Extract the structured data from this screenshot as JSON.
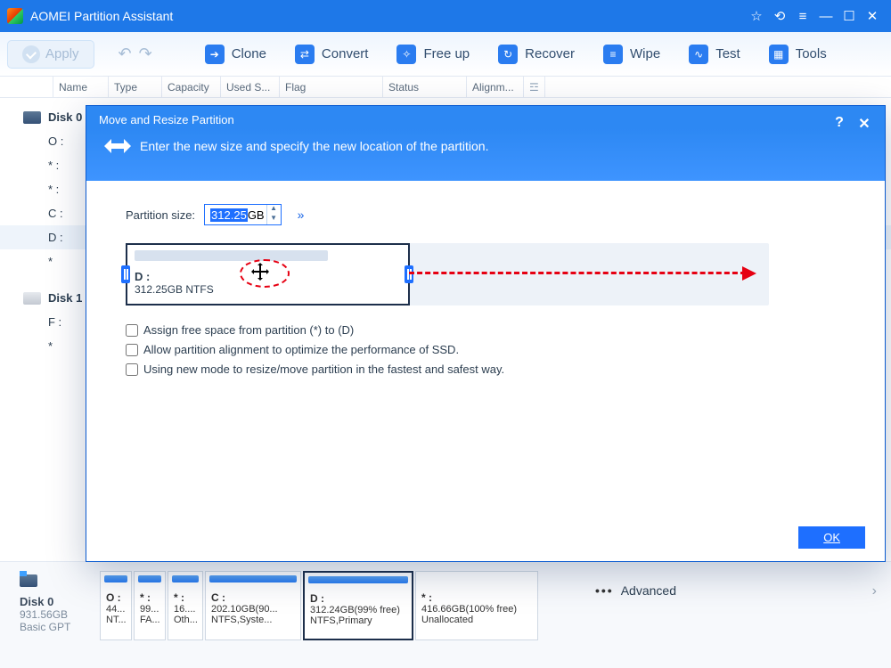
{
  "app": {
    "title": "AOMEI Partition Assistant"
  },
  "toolbar": {
    "apply": "Apply",
    "items": [
      "Clone",
      "Convert",
      "Free up",
      "Recover",
      "Wipe",
      "Test",
      "Tools"
    ]
  },
  "columns": [
    "Name",
    "Type",
    "Capacity",
    "Used S...",
    "Flag",
    "Status",
    "Alignm..."
  ],
  "tree": {
    "disk0": "Disk 0",
    "disk0_parts": [
      "O :",
      "* :",
      "* :",
      "C :",
      "D :",
      "*"
    ],
    "disk1": "Disk 1",
    "disk1_parts": [
      "F :",
      "*"
    ]
  },
  "dialog": {
    "title": "Move and Resize Partition",
    "subtitle": "Enter the new size and specify the new location of the partition.",
    "size_label": "Partition size:",
    "size_value_hl": "312.25",
    "size_value_unit": "GB",
    "more": "»",
    "part_label": "D :",
    "part_info": "312.25GB NTFS",
    "check1": "Assign free space from partition (*) to (D)",
    "check2": "Allow partition alignment to optimize the performance of SSD.",
    "check3": "Using new mode to resize/move partition in the fastest and safest way.",
    "ok": "OK"
  },
  "summary": {
    "name": "Disk 0",
    "size": "931.56GB",
    "type": "Basic GPT"
  },
  "blocks": [
    {
      "l": "O :",
      "a": "44...",
      "b": "NT..."
    },
    {
      "l": "* :",
      "a": "99...",
      "b": "FA..."
    },
    {
      "l": "* :",
      "a": "16....",
      "b": "Oth..."
    },
    {
      "l": "C :",
      "a": "202.10GB(90...",
      "b": "NTFS,Syste..."
    },
    {
      "l": "D :",
      "a": "312.24GB(99% free)",
      "b": "NTFS,Primary"
    },
    {
      "l": "* :",
      "a": "416.66GB(100% free)",
      "b": "Unallocated"
    }
  ],
  "advanced": "Advanced"
}
